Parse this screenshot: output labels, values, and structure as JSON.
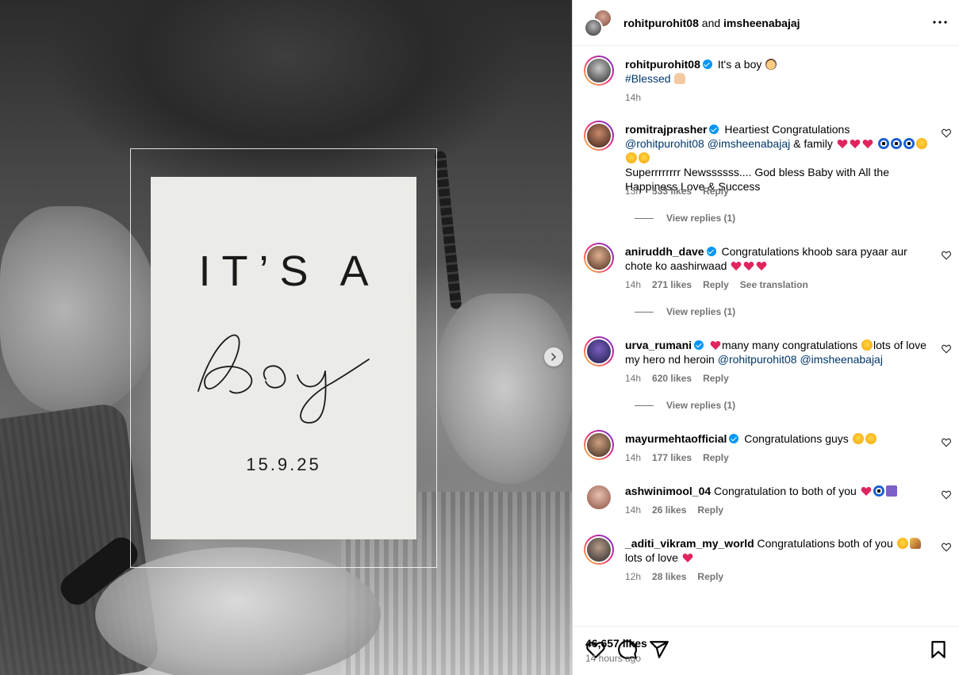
{
  "header": {
    "user1": "rohitpurohit08",
    "and": "and",
    "user2": "imsheenabajaj"
  },
  "media": {
    "card_line1": "IT’S A",
    "card_script": "boy",
    "card_date": "15.9.25"
  },
  "caption": {
    "username": "rohitpurohit08",
    "text": "It's a boy",
    "hashtag": "#Blessed",
    "time": "14h"
  },
  "comments": [
    {
      "username": "romitrajprasher",
      "text_a": "Heartiest Congratulations",
      "mention1": "@rohitpurohit08",
      "mention2": "@imsheenabajaj",
      "text_b": "& family",
      "text_c": "Superrrrrrrr Newssssss.... God bless Baby with All the Happiness Love & Success",
      "time": "13h",
      "likes": "533 likes",
      "reply": "Reply",
      "view_replies": "View replies (1)"
    },
    {
      "username": "aniruddh_dave",
      "text": "Congratulations khoob sara pyaar aur chote ko aashirwaad",
      "time": "14h",
      "likes": "271 likes",
      "reply": "Reply",
      "translate": "See translation",
      "view_replies": "View replies (1)"
    },
    {
      "username": "urva_rumani",
      "text_a": "many many congratulations",
      "text_b": "lots of love my hero nd heroin",
      "mention1": "@rohitpurohit08",
      "mention2": "@imsheenabajaj",
      "time": "14h",
      "likes": "620 likes",
      "reply": "Reply",
      "view_replies": "View replies (1)"
    },
    {
      "username": "mayurmehtaofficial",
      "text": "Congratulations guys",
      "time": "14h",
      "likes": "177 likes",
      "reply": "Reply"
    },
    {
      "username": "ashwinimool_04",
      "text": "Congratulation to both of you",
      "time": "14h",
      "likes": "26 likes",
      "reply": "Reply"
    },
    {
      "username": "_aditi_vikram_my_world",
      "text_a": "Congratulations both of you",
      "text_b": "lots of love",
      "time": "12h",
      "likes": "28 likes",
      "reply": "Reply"
    }
  ],
  "footer": {
    "likes": "46,657 likes",
    "time_ago": "14 hours ago"
  },
  "icons": [
    "heart-icon",
    "comment-icon",
    "share-icon",
    "bookmark-icon",
    "more-icon",
    "chevron-right-icon",
    "verified-icon"
  ],
  "colors": {
    "link": "#00376b",
    "verified": "#0095f6",
    "muted": "#737373",
    "heart": "#ed4956"
  }
}
